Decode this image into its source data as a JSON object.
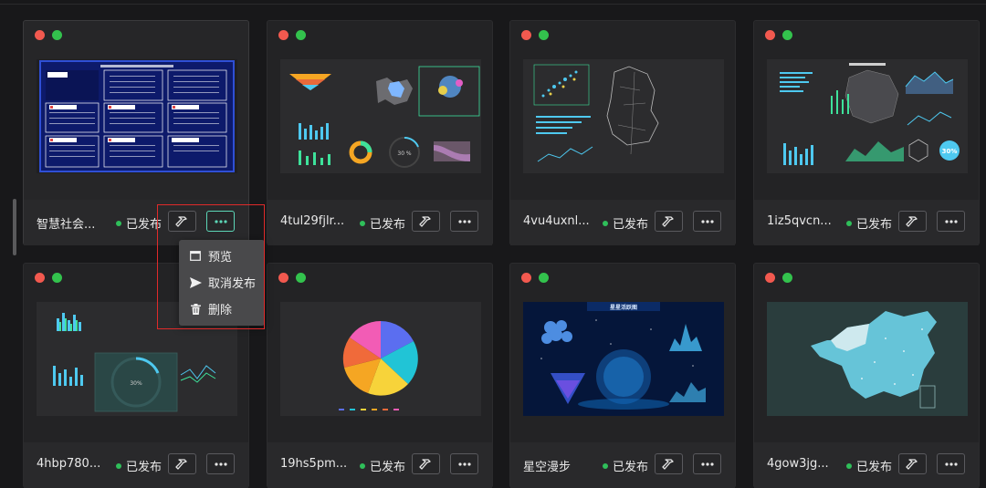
{
  "cards": [
    {
      "name": "智慧社会...",
      "status": "已发布"
    },
    {
      "name": "4tul29fjlr...",
      "status": "已发布"
    },
    {
      "name": "4vu4uxnl...",
      "status": "已发布"
    },
    {
      "name": "1iz5qvcn...",
      "status": "已发布"
    },
    {
      "name": "4hbp780...",
      "status": "已发布"
    },
    {
      "name": "19hs5pm...",
      "status": "已发布"
    },
    {
      "name": "星空漫步",
      "status": "已发布"
    },
    {
      "name": "4gow3jg...",
      "status": "已发布"
    }
  ],
  "menu": {
    "preview": "预览",
    "unpublish": "取消发布",
    "delete": "删除"
  },
  "thumb_text": {
    "pie_pct": "30 %",
    "ring_pct": "30%",
    "starry_title": "星星活跃图"
  },
  "icons": {
    "edit": "hammer-icon",
    "more": "more-dots-icon",
    "preview": "window-icon",
    "unpublish": "send-icon",
    "delete": "trash-icon"
  },
  "colors": {
    "published": "#2fbf5a",
    "accent": "#5cd6b7",
    "highlight": "#e02a2a"
  }
}
